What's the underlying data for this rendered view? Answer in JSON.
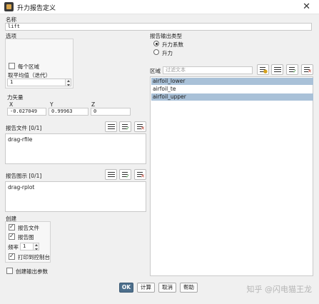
{
  "window": {
    "title": "升力报告定义"
  },
  "name": {
    "label": "名称",
    "value": "lift"
  },
  "options": {
    "label": "选项",
    "per_zone_label": "每个区域",
    "per_zone_checked": false,
    "average_label": "取平均值（迭代）",
    "average_value": "1"
  },
  "report_output_type": {
    "label": "报告输出类型",
    "options": [
      "升力系数",
      "升力"
    ],
    "selected_index": 0
  },
  "force_vector": {
    "label": "力矢量",
    "x_label": "X",
    "y_label": "Y",
    "z_label": "Z",
    "x_value": "-0.027049",
    "y_value": "0.99963",
    "z_value": "0"
  },
  "zones": {
    "label": "区域",
    "filter_placeholder": "过滤文本",
    "items": [
      "airfoil_lower",
      "airfoil_te",
      "airfoil_upper"
    ],
    "selected": [
      true,
      false,
      true
    ]
  },
  "report_files": {
    "label": "报告文件 [0/1]",
    "items": [
      "drag-rfile"
    ]
  },
  "report_plots": {
    "label": "报告图示 [0/1]",
    "items": [
      "drag-rplot"
    ]
  },
  "create": {
    "label": "创建",
    "report_file_label": "报告文件",
    "report_file_checked": true,
    "report_plot_label": "报告图",
    "report_plot_checked": true,
    "frequency_label": "频率",
    "frequency_value": "1",
    "print_console_label": "打印到控制台",
    "print_console_checked": true
  },
  "create_output_param": {
    "label": "创建输出参数",
    "checked": false
  },
  "buttons": {
    "ok": "OK",
    "compute": "计算",
    "cancel": "取消",
    "help": "帮助"
  },
  "watermark": "知乎 @闪电猫王龙",
  "colors": {
    "accent": "#4d6f8c",
    "selection": "#a9c1d8",
    "background": "#f0f0f0"
  }
}
